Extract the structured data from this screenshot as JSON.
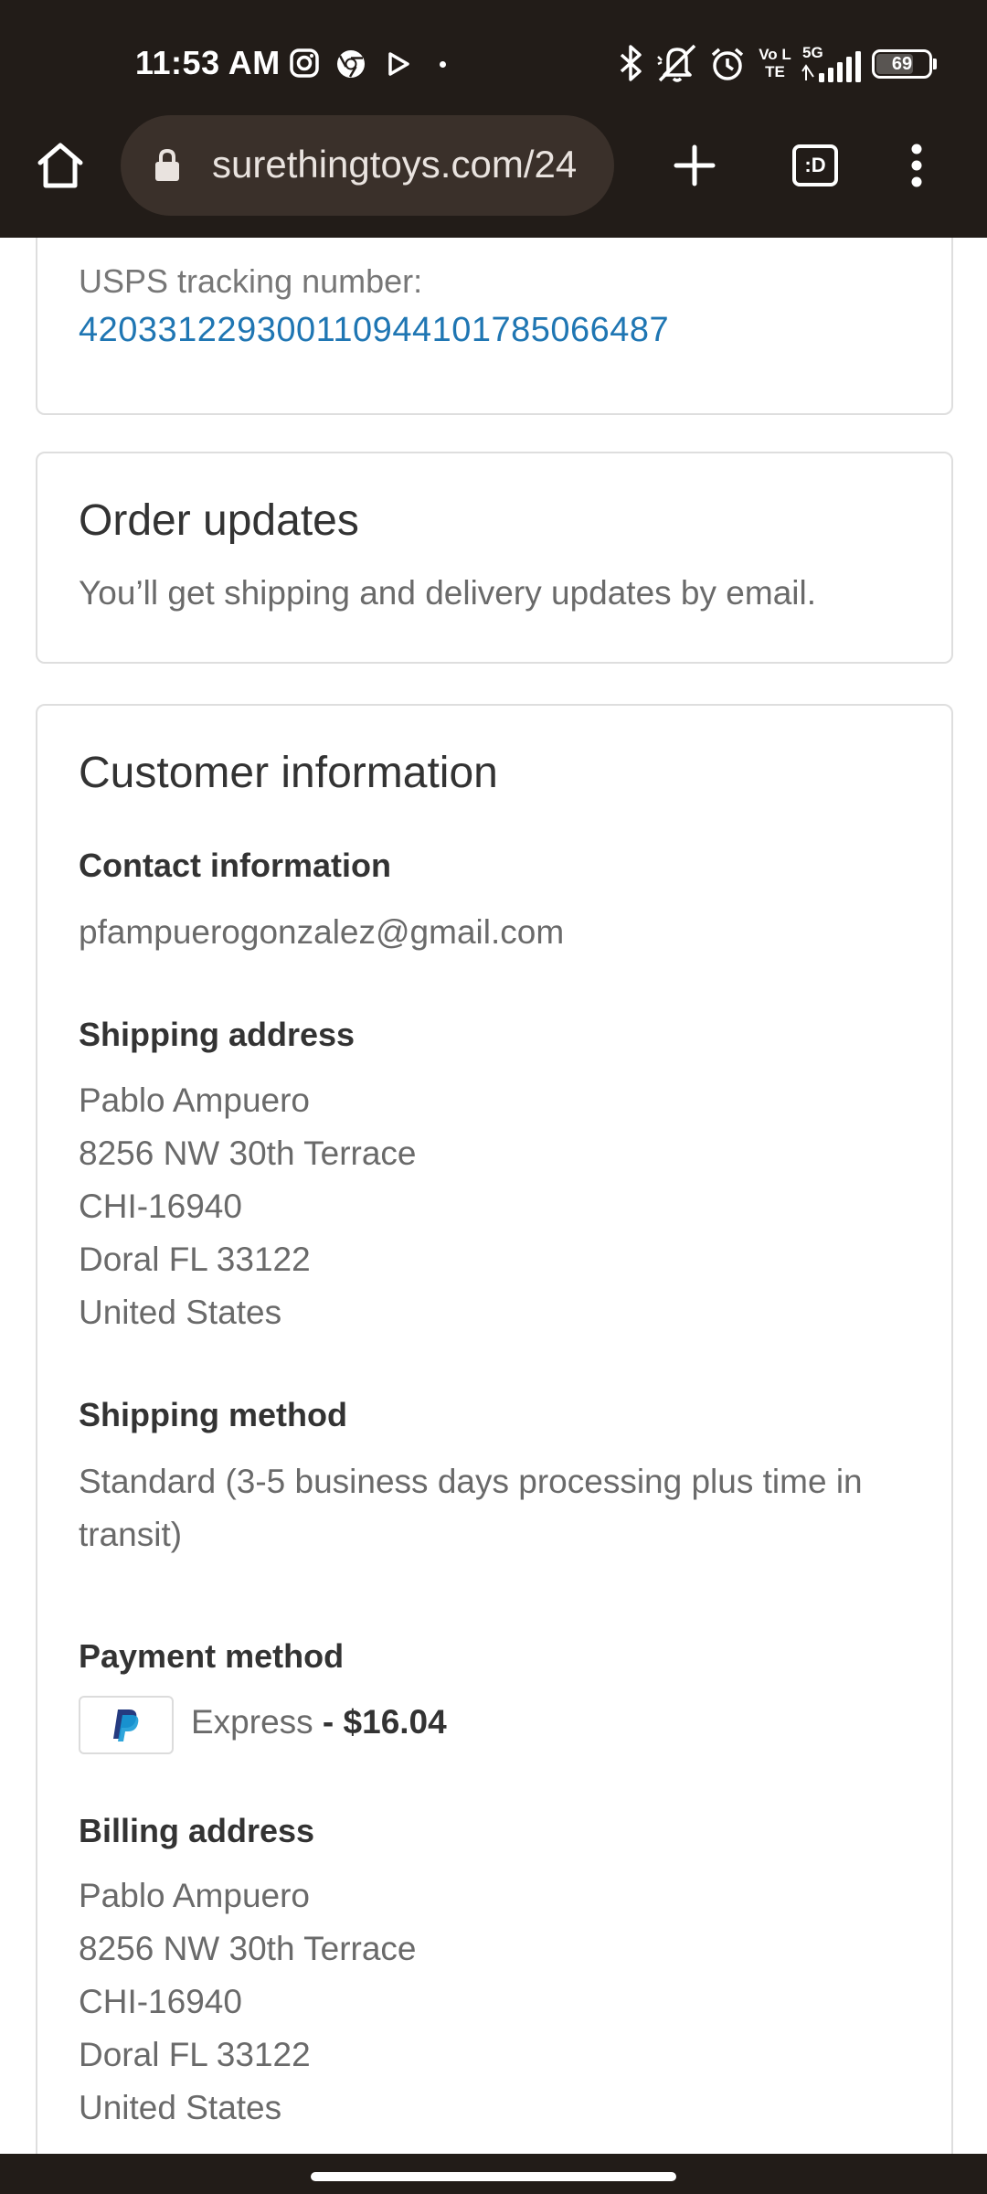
{
  "status_bar": {
    "time": "11:53 AM",
    "network": "5G",
    "volte": "Vo LTE",
    "battery": "69",
    "icons": [
      "instagram-icon",
      "chrome-icon",
      "play-icon",
      "dot-icon",
      "bluetooth-icon",
      "mute-icon",
      "alarm-icon",
      "volte-icon",
      "signal-icon",
      "battery-icon"
    ]
  },
  "browser": {
    "url": "surethingtoys.com/24",
    "tab_count": ":D",
    "icons": [
      "home-icon",
      "lock-icon",
      "plus-icon",
      "tabs-icon",
      "more-icon"
    ]
  },
  "tracking": {
    "label": "USPS tracking number:",
    "number": "420331229300110944101785066487"
  },
  "order_updates": {
    "title": "Order updates",
    "text": "You’ll get shipping and delivery updates by email."
  },
  "customer": {
    "title": "Customer information",
    "contact": {
      "heading": "Contact information",
      "email": "pfampuerogonzalez@gmail.com"
    },
    "shipping_address": {
      "heading": "Shipping address",
      "lines": [
        "Pablo Ampuero",
        "8256 NW 30th Terrace",
        "CHI-16940",
        "Doral FL 33122",
        "United States"
      ]
    },
    "shipping_method": {
      "heading": "Shipping method",
      "lines": [
        "Standard (3-5 business days processing plus time in",
        "transit)"
      ]
    },
    "payment_method": {
      "heading": "Payment method",
      "method": "Express",
      "separator": " - ",
      "amount": "$16.04",
      "brand_color": "#253b80",
      "brand_color_light": "#179bd7"
    },
    "billing_address": {
      "heading": "Billing address",
      "lines": [
        "Pablo Ampuero",
        "8256 NW 30th Terrace",
        "CHI-16940",
        "Doral FL 33122",
        "United States"
      ]
    }
  }
}
